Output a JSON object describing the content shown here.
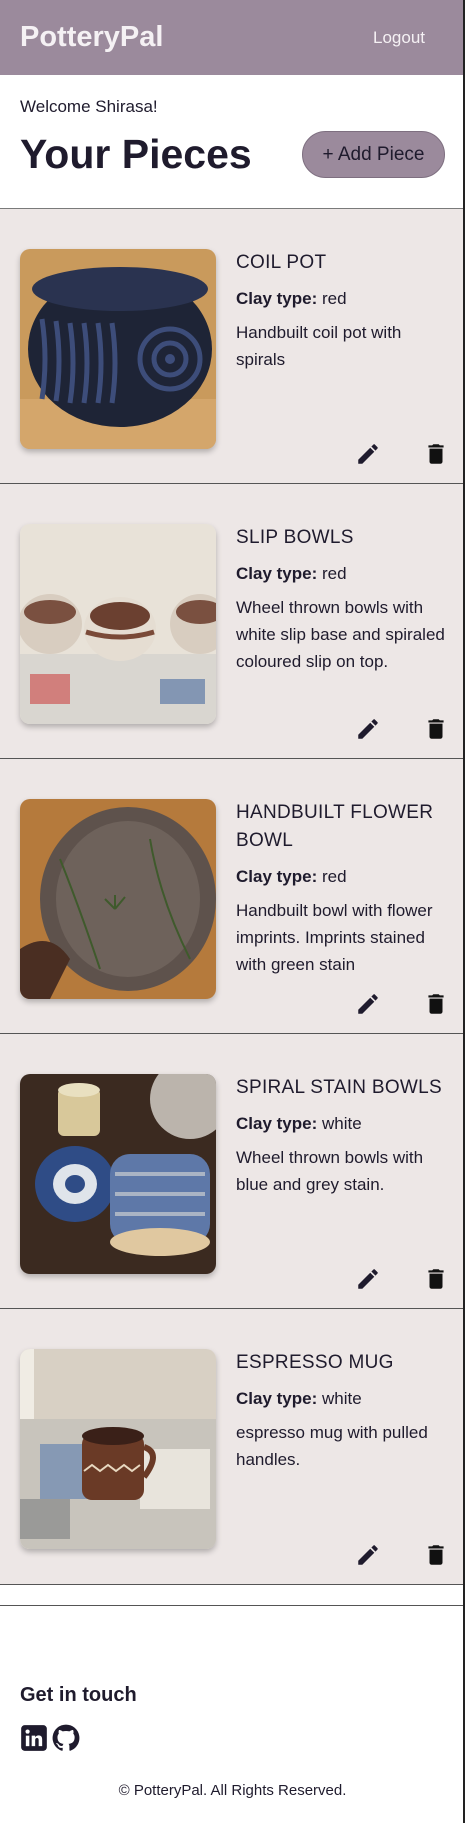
{
  "header": {
    "brand": "PotteryPal",
    "logout_label": "Logout"
  },
  "intro": {
    "welcome": "Welcome Shirasa!",
    "title": "Your Pieces",
    "add_label": "+ Add Piece"
  },
  "pieces": [
    {
      "name": "COIL POT",
      "clay_label": "Clay type:",
      "clay": "red",
      "description": "Handbuilt coil pot with spirals"
    },
    {
      "name": "SLIP BOWLS",
      "clay_label": "Clay type:",
      "clay": "red",
      "description": "Wheel thrown bowls with white slip base and spiraled coloured slip on top."
    },
    {
      "name": "HANDBUILT FLOWER BOWL",
      "clay_label": "Clay type:",
      "clay": "red",
      "description": "Handbuilt bowl with flower imprints. Imprints stained with green stain"
    },
    {
      "name": "SPIRAL STAIN BOWLS",
      "clay_label": "Clay type:",
      "clay": "white",
      "description": "Wheel thrown bowls with blue and grey stain."
    },
    {
      "name": "ESPRESSO MUG",
      "clay_label": "Clay type:",
      "clay": "white",
      "description": "espresso mug with pulled handles."
    }
  ],
  "footer": {
    "get_in_touch": "Get in touch",
    "copyright": "© PotteryPal. All Rights Reserved."
  },
  "icons": {
    "edit": "pencil-icon",
    "delete": "trash-icon",
    "linkedin": "linkedin-icon",
    "github": "github-icon"
  },
  "colors": {
    "header_bg": "#9b8a9c",
    "card_bg": "#ede7e6",
    "text": "#1f1b2d"
  }
}
